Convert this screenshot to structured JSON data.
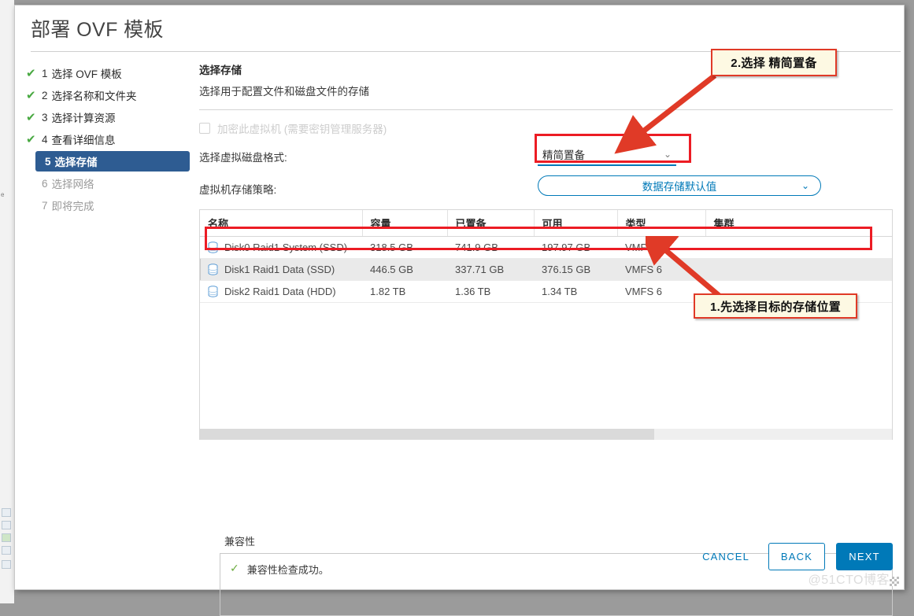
{
  "dialog": {
    "title": "部署 OVF 模板"
  },
  "steps": [
    {
      "num": "1",
      "label": "选择 OVF 模板",
      "state": "done"
    },
    {
      "num": "2",
      "label": "选择名称和文件夹",
      "state": "done"
    },
    {
      "num": "3",
      "label": "选择计算资源",
      "state": "done"
    },
    {
      "num": "4",
      "label": "查看详细信息",
      "state": "done"
    },
    {
      "num": "5",
      "label": "选择存储",
      "state": "current"
    },
    {
      "num": "6",
      "label": "选择网络",
      "state": "pending"
    },
    {
      "num": "7",
      "label": "即将完成",
      "state": "pending"
    }
  ],
  "panel": {
    "title": "选择存储",
    "subtitle": "选择用于配置文件和磁盘文件的存储",
    "encrypt_label": "加密此虚拟机 (需要密钥管理服务器)",
    "disk_format_label": "选择虚拟磁盘格式:",
    "disk_format_value": "精简置备",
    "storage_policy_label": "虚拟机存储策略:",
    "storage_policy_value": "数据存储默认值"
  },
  "table": {
    "columns": [
      "名称",
      "容量",
      "已置备",
      "可用",
      "类型",
      "集群"
    ],
    "rows": [
      {
        "name": "Disk0 Raid1 System (SSD)",
        "capacity": "318.5 GB",
        "provisioned": "741.9 GB",
        "free": "197.97 GB",
        "type": "VMFS 6",
        "cluster": "",
        "selected": false
      },
      {
        "name": "Disk1 Raid1 Data (SSD)",
        "capacity": "446.5 GB",
        "provisioned": "337.71 GB",
        "free": "376.15 GB",
        "type": "VMFS 6",
        "cluster": "",
        "selected": true
      },
      {
        "name": "Disk2 Raid1 Data (HDD)",
        "capacity": "1.82 TB",
        "provisioned": "1.36 TB",
        "free": "1.34 TB",
        "type": "VMFS 6",
        "cluster": "",
        "selected": false
      }
    ]
  },
  "compatibility": {
    "label": "兼容性",
    "message": "兼容性检查成功。"
  },
  "footer": {
    "cancel": "CANCEL",
    "back": "BACK",
    "next": "NEXT"
  },
  "watermark": "@51CTO博客",
  "annotations": [
    {
      "id": "1",
      "text": "1.先选择目标的存储位置"
    },
    {
      "id": "2",
      "text": "2.选择 精简置备"
    }
  ],
  "colors": {
    "accent": "#0079b8",
    "step_active_bg": "#2e5c92",
    "check_green": "#49a942",
    "annotation_red": "#ec1c24",
    "annotation_bg": "#fdf9e3"
  }
}
